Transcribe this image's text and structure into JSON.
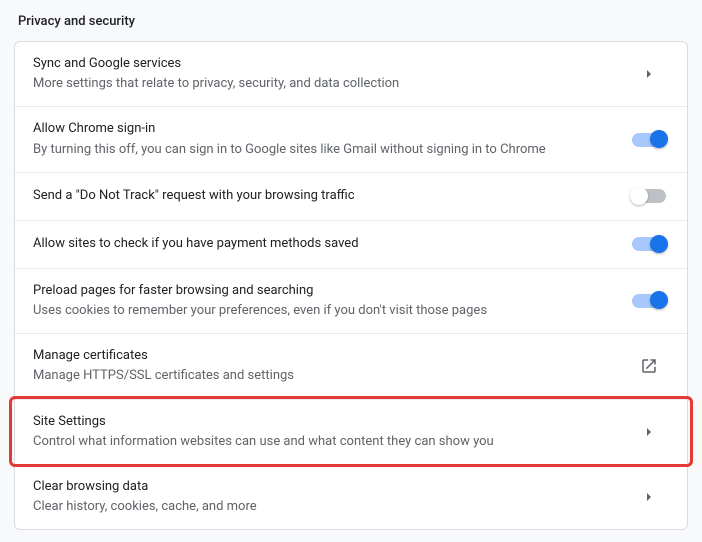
{
  "page_title": "Privacy and security",
  "rows": [
    {
      "title": "Sync and Google services",
      "subtitle": "More settings that relate to privacy, security, and data collection",
      "action": "caret"
    },
    {
      "title": "Allow Chrome sign-in",
      "subtitle": "By turning this off, you can sign in to Google sites like Gmail without signing in to Chrome",
      "action": "toggle",
      "toggle_on": true
    },
    {
      "title": "Send a \"Do Not Track\" request with your browsing traffic",
      "subtitle": "",
      "action": "toggle",
      "toggle_on": false
    },
    {
      "title": "Allow sites to check if you have payment methods saved",
      "subtitle": "",
      "action": "toggle",
      "toggle_on": true
    },
    {
      "title": "Preload pages for faster browsing and searching",
      "subtitle": "Uses cookies to remember your preferences, even if you don't visit those pages",
      "action": "toggle",
      "toggle_on": true
    },
    {
      "title": "Manage certificates",
      "subtitle": "Manage HTTPS/SSL certificates and settings",
      "action": "external"
    },
    {
      "title": "Site Settings",
      "subtitle": "Control what information websites can use and what content they can show you",
      "action": "caret",
      "highlight": true
    },
    {
      "title": "Clear browsing data",
      "subtitle": "Clear history, cookies, cache, and more",
      "action": "caret"
    }
  ]
}
